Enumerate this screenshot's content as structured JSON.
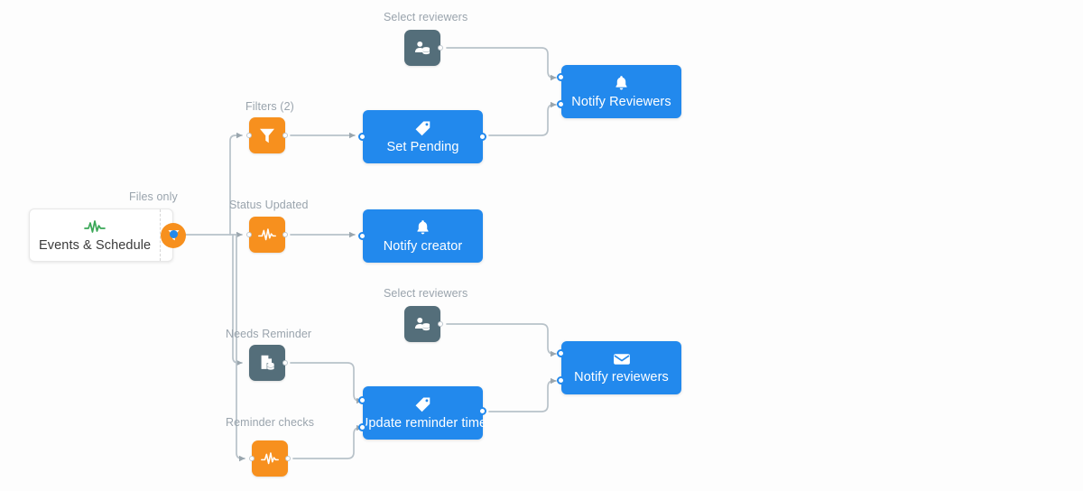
{
  "diagram": {
    "type": "workflow-automation-graph",
    "background_color": "#fdfdfd",
    "colors": {
      "accent_blue": "#2289ED",
      "accent_orange": "#F7901E",
      "node_slate": "#546E7A",
      "wire": "#b8c2c9",
      "caption_text": "#9aa4ad",
      "trigger_icon_green": "#3aa757"
    }
  },
  "trigger": {
    "label": "Events & Schedule",
    "icon": "activity-pulse-icon",
    "filter_icon": "funnel-icon",
    "filter_caption": "Files only"
  },
  "captions": {
    "select_reviewers_top": "Select reviewers",
    "filters": "Filters (2)",
    "status_updated": "Status Updated",
    "select_reviewers_bottom": "Select reviewers",
    "needs_reminder": "Needs Reminder",
    "reminder_checks": "Reminder checks"
  },
  "nodes": {
    "select_reviewers_top": {
      "icon": "person-database-icon",
      "kind": "slate"
    },
    "filters": {
      "icon": "funnel-icon",
      "kind": "orange"
    },
    "status_updated": {
      "icon": "activity-pulse-icon",
      "kind": "orange"
    },
    "select_reviewers_bottom": {
      "icon": "person-database-icon",
      "kind": "slate"
    },
    "needs_reminder": {
      "icon": "document-database-icon",
      "kind": "slate"
    },
    "reminder_checks": {
      "icon": "activity-pulse-icon",
      "kind": "orange"
    }
  },
  "actions": {
    "notify_reviewers_top": {
      "label": "Notify Reviewers",
      "icon": "bell-icon"
    },
    "set_pending": {
      "label": "Set Pending",
      "icon": "tag-icon"
    },
    "notify_creator": {
      "label": "Notify creator",
      "icon": "bell-icon"
    },
    "notify_reviewers_bottom": {
      "label": "Notify reviewers",
      "icon": "envelope-icon"
    },
    "update_reminder_time": {
      "label": "Update reminder time",
      "icon": "tag-icon"
    }
  }
}
